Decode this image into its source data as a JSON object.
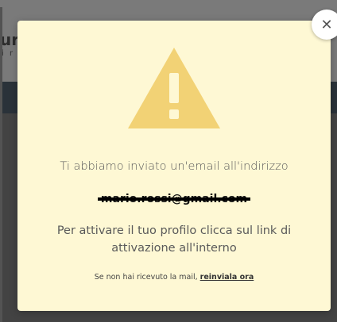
{
  "background": {
    "title": "ur",
    "subtitle": "i r"
  },
  "modal": {
    "sent_text": "Ti abbiamo inviato un'email all'indirizzo",
    "email": "mario.rossi@gmail.com",
    "activate_text": "Per attivare il tuo profilo clicca sul link di attivazione all'interno",
    "resend_prefix": "Se non hai ricevuto la mail, ",
    "resend_link": "reinviala ora",
    "close_icon": "close-icon",
    "warning_icon": "warning-icon"
  },
  "colors": {
    "modal_background": "#fef8d4",
    "warning_icon": "#f2d275",
    "overlay": "rgba(40,40,40,0.62)",
    "nav": "#2f4256"
  }
}
